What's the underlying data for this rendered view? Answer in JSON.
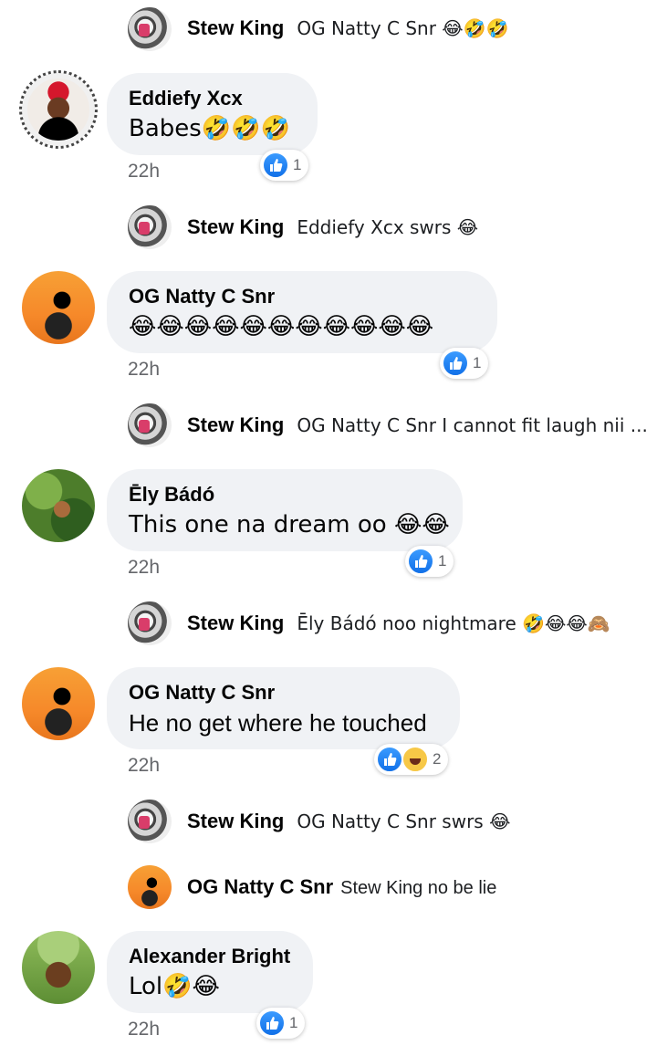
{
  "like_color": "#1877f2",
  "haha_color": "#f7c847",
  "comments": [
    {
      "name": "Eddiefy Xcx",
      "text": "Babes🤣🤣🤣",
      "time": "22h",
      "reactions": "1"
    },
    {
      "name": "OG Natty C Snr",
      "text": "😂😂😂😂😂😂😂😂😂😂😂",
      "time": "22h",
      "reactions": "1"
    },
    {
      "name": "Ēly Bádó",
      "text": "This one na dream oo 😂😂",
      "time": "22h",
      "reactions": "1"
    },
    {
      "name": "OG Natty C Snr",
      "text": "He no get where he touched",
      "time": "22h",
      "reactions": "2"
    },
    {
      "name": "Alexander Bright",
      "text": "Lol🤣😂",
      "time": "22h",
      "reactions": "1"
    }
  ],
  "replies": [
    {
      "name": "Stew King",
      "text": "OG Natty C Snr 😂🤣🤣"
    },
    {
      "name": "Stew King",
      "text": "Eddiefy Xcx swrs 😂"
    },
    {
      "name": "Stew King",
      "text": "OG Natty C Snr I cannot fit laugh nii ..."
    },
    {
      "name": "Stew King",
      "text": "Ēly Bádó noo nightmare 🤣😂😂🙈"
    },
    {
      "name": "Stew King",
      "text": "OG Natty C Snr swrs 😂"
    },
    {
      "name": "OG Natty C Snr",
      "text": "Stew King no be lie"
    }
  ]
}
